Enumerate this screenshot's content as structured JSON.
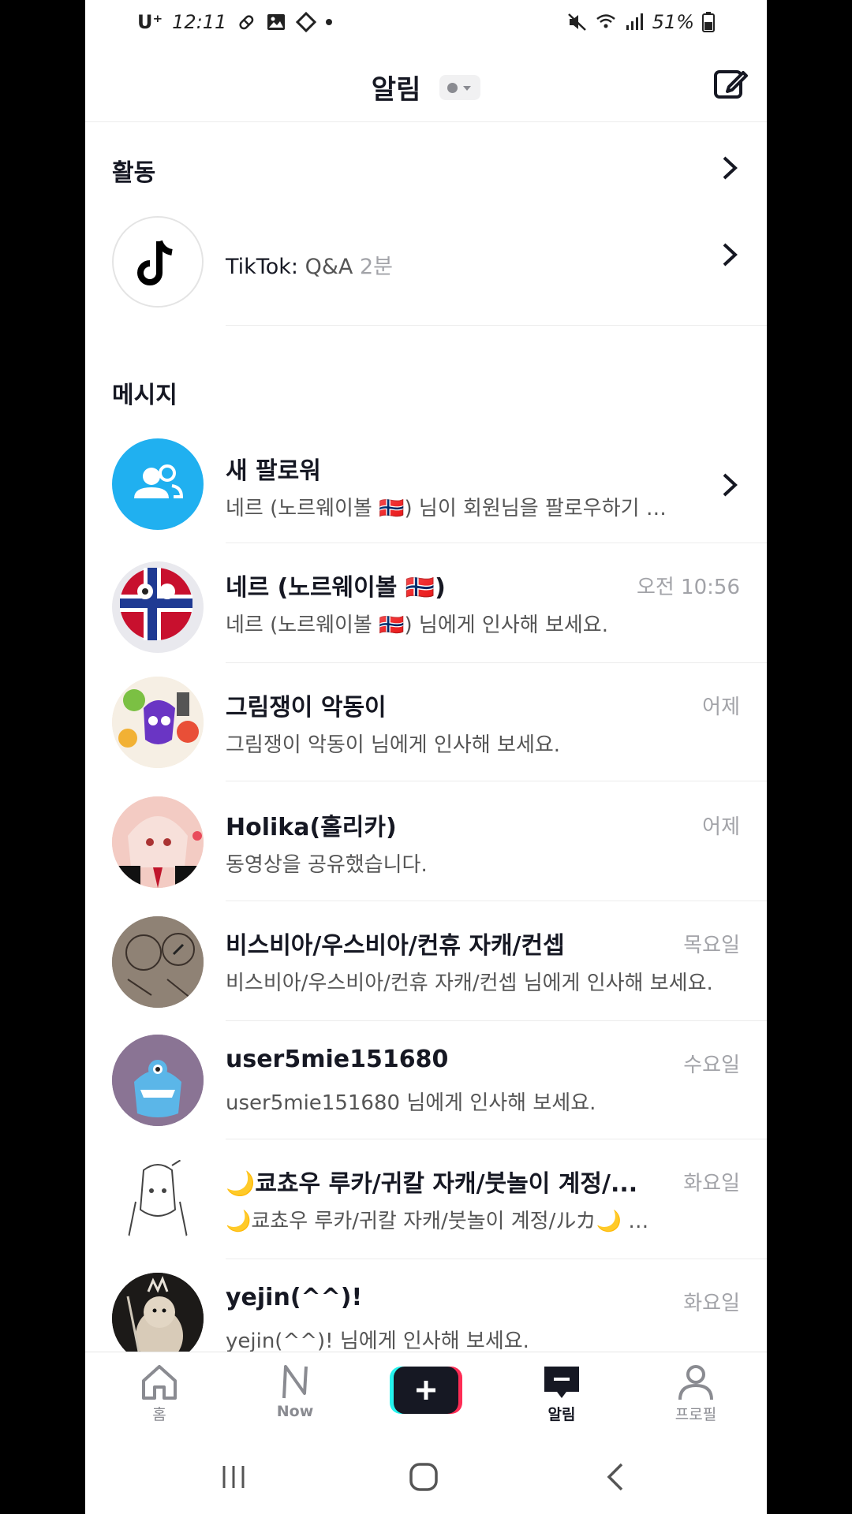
{
  "status_bar": {
    "carrier": "U⁺",
    "time": "12:11",
    "battery": "51%"
  },
  "header": {
    "title": "알림"
  },
  "activity": {
    "title": "활동",
    "item": {
      "name": "TikTok:",
      "text": "Q&A",
      "time": "2분"
    }
  },
  "messages": {
    "title": "메시지",
    "items": [
      {
        "name": "새 팔로워",
        "sub": "네르 (노르웨이볼 🇳🇴) 님이 회원님을 팔로우하기 시...",
        "time": ""
      },
      {
        "name": "네르 (노르웨이볼 🇳🇴)",
        "sub": "네르 (노르웨이볼 🇳🇴) 님에게 인사해 보세요.",
        "time": "오전 10:56"
      },
      {
        "name": "그림쟁이 악동이",
        "sub": "그림쟁이 악동이 님에게 인사해 보세요.",
        "time": "어제"
      },
      {
        "name": "Holika(홀리카)",
        "sub": "동영상을 공유했습니다.",
        "time": "어제"
      },
      {
        "name": "비스비아/우스비아/컨휴 자캐/컨셉",
        "sub": "비스비아/우스비아/컨휴 자캐/컨셉 님에게 인사해 보세요.",
        "time": "목요일"
      },
      {
        "name": "user5mie151680",
        "sub": "user5mie151680 님에게 인사해 보세요.",
        "time": "수요일"
      },
      {
        "name": "🌙쿄쵸우 루카/귀칼 자캐/붓놀이 계정/...",
        "sub": "🌙쿄쵸우 루카/귀칼 자캐/붓놀이 계정/ルカ🌙 님에게 ...",
        "time": "화요일"
      },
      {
        "name": "yejin(^^)!",
        "sub": "yejin(^^)! 님에게 인사해 보세요.",
        "time": "화요일"
      }
    ]
  },
  "bottom_nav": {
    "home": "홈",
    "now": "Now",
    "inbox": "알림",
    "profile": "프로필"
  },
  "colors": {
    "accent_blue": "#20b0f0",
    "cyan": "#25f4ee",
    "pink": "#fe2c55",
    "text": "#161823",
    "muted": "#a2a3a8"
  }
}
